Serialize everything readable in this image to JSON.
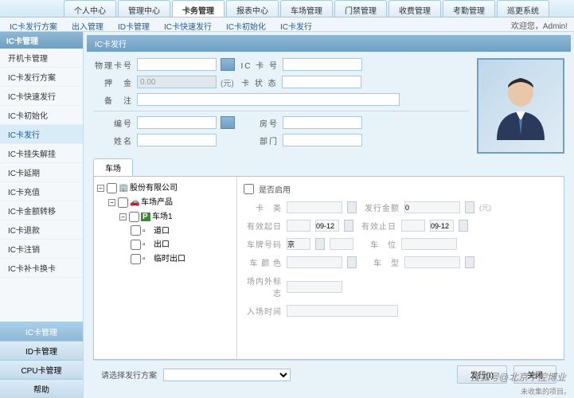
{
  "top_tabs": [
    "个人中心",
    "管理中心",
    "卡务管理",
    "报表中心",
    "车场管理",
    "门禁管理",
    "收费管理",
    "考勤管理",
    "巡更系统"
  ],
  "top_tab_active": 2,
  "sub_tabs": [
    "IC卡发行方案",
    "出入管理",
    "ID卡管理",
    "IC卡快速发行",
    "IC卡初始化",
    "IC卡发行"
  ],
  "welcome_prefix": "欢迎您，",
  "welcome_user": "Admin!",
  "sidebar": {
    "header": "IC卡管理",
    "items": [
      "开机卡管理",
      "IC卡发行方案",
      "IC卡快速发行",
      "IC卡初始化",
      "IC卡发行",
      "IC卡挂失解挂",
      "IC卡延期",
      "IC卡充值",
      "IC卡金额转移",
      "IC卡退款",
      "IC卡注销",
      "IC卡补卡换卡"
    ],
    "active": 4,
    "bottom": [
      "IC卡管理",
      "ID卡管理",
      "CPU卡管理",
      "帮助"
    ],
    "bottom_active": 0
  },
  "panel_title": "IC卡发行",
  "form": {
    "physical_card": "物理卡号",
    "ic_card": "IC 卡 号",
    "deposit": "押　金",
    "deposit_value": "0.00",
    "deposit_unit": "(元)",
    "card_status": "卡 状 态",
    "remark": "备　注",
    "number": "编号",
    "room": "房号",
    "name": "姓名",
    "dept": "部门"
  },
  "tab_label": "车场",
  "enable_label": "是否启用",
  "tree": {
    "root": "股份有限公司",
    "l1": "车场产品",
    "l2": "车场1",
    "leaves": [
      "道口",
      "出口",
      "临时出口"
    ]
  },
  "detail": {
    "type": "卡　类",
    "amount": "发行金额",
    "amount_value": "0",
    "amount_unit": "(元)",
    "valid_from": "有效起日",
    "valid_from_value": "09-12",
    "valid_to": "有效止日",
    "valid_to_value": "09-12",
    "plate": "车牌号码",
    "plate_prefix": "京",
    "slot": "车　位",
    "color": "车 颜 色",
    "model": "车　型",
    "inout": "场内外标志",
    "entry_time": "入场时间"
  },
  "bottom": {
    "scheme_label": "请选择发行方案",
    "issue_btn": "发行(I)",
    "close_btn": "关闭"
  },
  "watermark": "搜狐号@北京中控博业",
  "footer_note": "未收集的项目。"
}
